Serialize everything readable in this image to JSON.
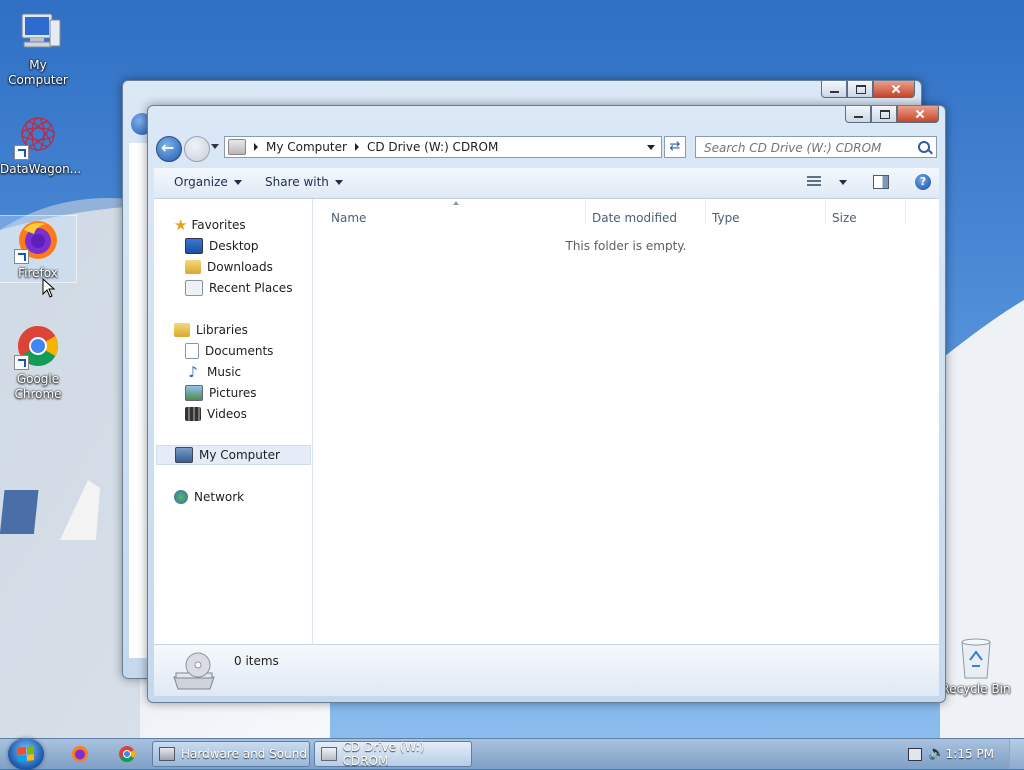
{
  "desktop": {
    "icons": [
      {
        "label": "My Computer",
        "icon": "computer-icon"
      },
      {
        "label": "DataWagon...",
        "icon": "datawagon-icon"
      },
      {
        "label": "Firefox",
        "icon": "firefox-icon"
      },
      {
        "label": "Google Chrome",
        "icon": "chrome-icon"
      },
      {
        "label": "Recycle Bin",
        "icon": "recycle-bin-icon"
      }
    ]
  },
  "explorer": {
    "address": {
      "crumbs": [
        "My Computer",
        "CD Drive (W:) CDROM"
      ]
    },
    "search": {
      "placeholder": "Search CD Drive (W:) CDROM"
    },
    "toolbar": {
      "organize_label": "Organize",
      "share_label": "Share with"
    },
    "nav": {
      "favorites": {
        "label": "Favorites",
        "items": [
          "Desktop",
          "Downloads",
          "Recent Places"
        ]
      },
      "libraries": {
        "label": "Libraries",
        "items": [
          "Documents",
          "Music",
          "Pictures",
          "Videos"
        ]
      },
      "computer": {
        "label": "My Computer"
      },
      "network": {
        "label": "Network"
      }
    },
    "columns": [
      "Name",
      "Date modified",
      "Type",
      "Size"
    ],
    "empty_message": "This folder is empty.",
    "status": {
      "items_text": "0 items"
    }
  },
  "taskbar": {
    "buttons": [
      {
        "label": "Hardware and Sound"
      },
      {
        "label": "CD Drive (W:) CDROM"
      }
    ],
    "clock": "1:15 PM"
  },
  "colors": {
    "sky": "#4a8ad6",
    "selection": "#e3ecf7",
    "close_button": "#c6452c"
  }
}
